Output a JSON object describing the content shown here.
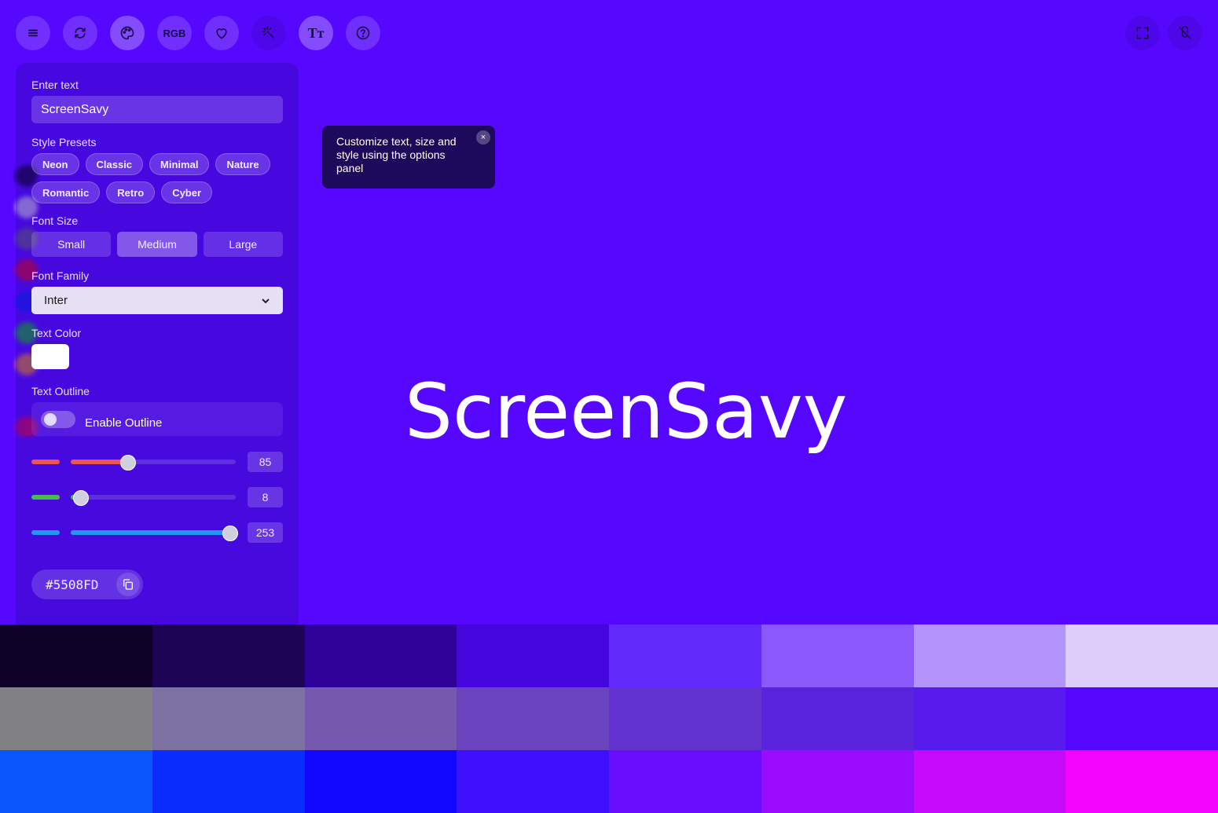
{
  "toolbar": {
    "buttons": [
      {
        "name": "menu-button",
        "icon": "menu-icon"
      },
      {
        "name": "refresh-button",
        "icon": "refresh-icon"
      },
      {
        "name": "palette-button",
        "icon": "palette-icon"
      },
      {
        "name": "rgb-button",
        "label": "RGB"
      },
      {
        "name": "favorite-button",
        "icon": "heart-icon"
      },
      {
        "name": "effects-button",
        "icon": "sparkle-icon"
      },
      {
        "name": "text-button",
        "label": "Tт"
      },
      {
        "name": "help-button",
        "icon": "help-icon"
      }
    ],
    "rgb_label": "RGB",
    "text_label": "Tт"
  },
  "panel": {
    "enter_text_label": "Enter text",
    "text_value": "ScreenSavy",
    "style_presets_label": "Style Presets",
    "presets": [
      "Neon",
      "Classic",
      "Minimal",
      "Nature",
      "Romantic",
      "Retro",
      "Cyber"
    ],
    "font_size_label": "Font Size",
    "font_sizes": [
      "Small",
      "Medium",
      "Large"
    ],
    "font_size_selected": "Medium",
    "font_family_label": "Font Family",
    "font_family_value": "Inter",
    "text_color_label": "Text Color",
    "text_color": "#FFFFFF",
    "outline_label": "Text Outline",
    "outline_toggle_label": "Enable Outline"
  },
  "rgb": {
    "red": 85,
    "green": 8,
    "blue": 253,
    "hex": "#5508FD"
  },
  "tooltip": {
    "text": "Customize text, size and style using the options panel",
    "close": "×"
  },
  "display_text": "ScreenSavy",
  "background_color": "#5508FD",
  "palette": [
    [
      "#0D0128",
      "#1D0454",
      "#2F0299",
      "#4506DE",
      "#6229FB",
      "#8B58FC",
      "#B393FC",
      "#DCCDFA"
    ],
    [
      "#818084",
      "#7C71A0",
      "#7559AF",
      "#6A43BE",
      "#6233CE",
      "#5A24DE",
      "#571BED",
      "#5508FD"
    ],
    [
      "#0A56FC",
      "#0A2CFC",
      "#1308FE",
      "#3E10FD",
      "#6A0CFD",
      "#9B0BFE",
      "#C80AFB",
      "#F305FD"
    ]
  ]
}
